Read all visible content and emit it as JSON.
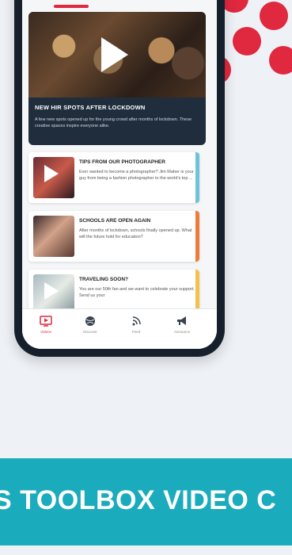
{
  "hero": {
    "title": "NEW HIR SPOTS AFTER LOCKDOWN",
    "description": "A few new spots opened up for the young crowd after months of lockdown. These creative spaces inspire everyone alike."
  },
  "cards": [
    {
      "title": "TIPS FROM OUR PHOTOGRAPHER",
      "description": "Ever wanted to become a photographer? Jim Maher is your guy from being a fashion photographer to the world's top ...",
      "accent": "#6ec3d8"
    },
    {
      "title": "SCHOOLS ARE OPEN AGAIN",
      "description": "After months of lockdown, schools finally opened up. What will the future hold for education?",
      "accent": "#ef7a3a"
    },
    {
      "title": "TRAVELING SOON?",
      "description": "You are our 50th fan and we want to celebrate your support. Send us your",
      "accent": "#f2c14e"
    }
  ],
  "tabbar": {
    "items": [
      {
        "label": "Videos",
        "icon": "video-icon",
        "active": true
      },
      {
        "label": "Discover",
        "icon": "globe-icon",
        "active": false
      },
      {
        "label": "Feed",
        "icon": "rss-icon",
        "active": false
      },
      {
        "label": "Announce",
        "icon": "megaphone-icon",
        "active": false
      }
    ]
  },
  "banner": {
    "text": "S TOOLBOX VIDEO C"
  },
  "colors": {
    "accent_red": "#e0283e",
    "banner_teal": "#1aabbc",
    "phone_body": "#16202c"
  }
}
